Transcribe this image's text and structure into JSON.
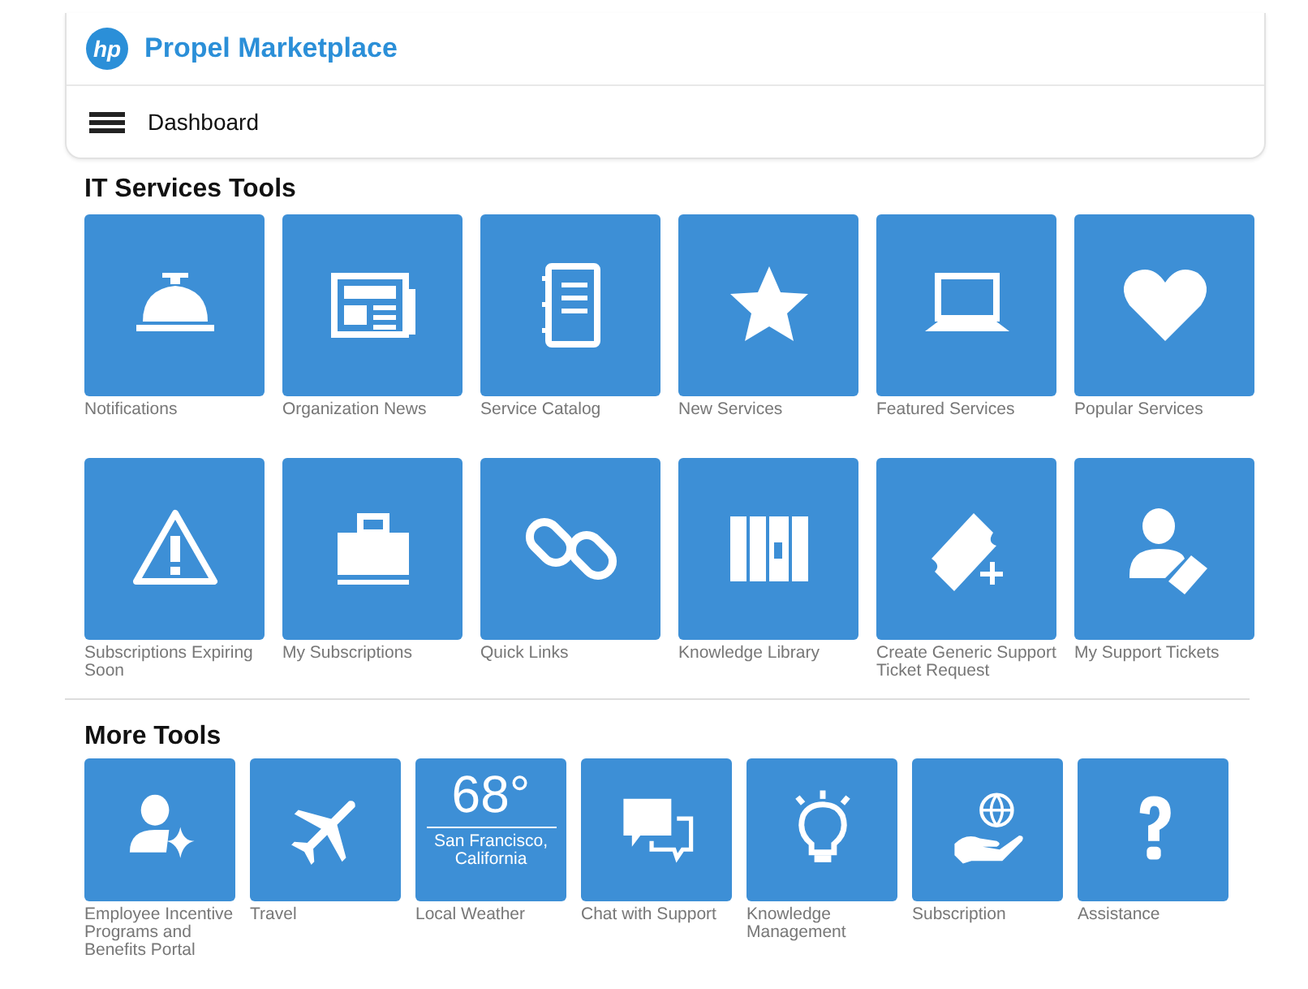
{
  "header": {
    "logo": "hp",
    "title": "Propel Marketplace",
    "nav_label": "Dashboard"
  },
  "sections": [
    {
      "title": "IT Services Tools",
      "tiles": [
        {
          "kind": "icon",
          "label": "Notifications"
        },
        {
          "kind": "icon",
          "label": "Organization News"
        },
        {
          "kind": "icon",
          "label": "Service Catalog"
        },
        {
          "kind": "icon",
          "label": "New Services"
        },
        {
          "kind": "icon",
          "label": "Featured Services"
        },
        {
          "kind": "icon",
          "label": "Popular Services"
        },
        {
          "kind": "icon",
          "label": "Subscriptions Expiring Soon"
        },
        {
          "kind": "icon",
          "label": "My Subscriptions"
        },
        {
          "kind": "icon",
          "label": "Quick Links"
        },
        {
          "kind": "icon",
          "label": "Knowledge Library"
        },
        {
          "kind": "icon",
          "label": "Create Generic Support Ticket Request"
        },
        {
          "kind": "icon",
          "label": "My Support Tickets"
        }
      ]
    },
    {
      "title": "More Tools",
      "tiles": [
        {
          "kind": "icon",
          "label": "Employee Incentive Programs and Benefits Portal"
        },
        {
          "kind": "icon",
          "label": "Travel"
        },
        {
          "kind": "weather",
          "temperature": "68°",
          "location": "San Francisco, California",
          "label": "Local Weather"
        },
        {
          "kind": "icon",
          "label": "Chat with Support"
        },
        {
          "kind": "icon",
          "label": "Knowledge Management"
        },
        {
          "kind": "icon",
          "label": "Subscription"
        },
        {
          "kind": "icon",
          "label": "Assistance"
        }
      ]
    }
  ]
}
